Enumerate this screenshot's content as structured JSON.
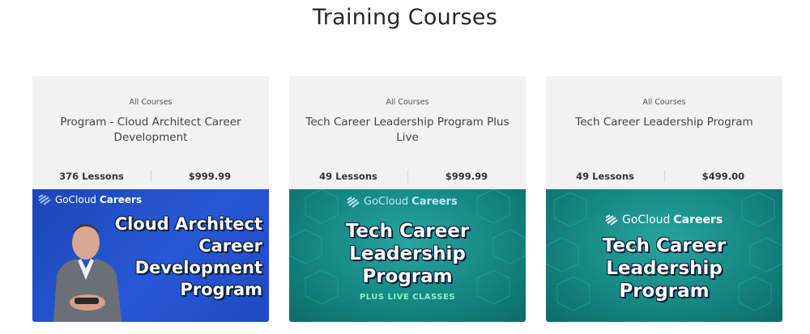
{
  "page": {
    "title": "Training Courses"
  },
  "courses": [
    {
      "category": "All Courses",
      "title": "Program - Cloud Architect Career Development",
      "lessons": "376 Lessons",
      "price": "$999.99",
      "thumbnail": {
        "brand_prefix": "GoCloud",
        "brand_suffix": "Careers",
        "lines": [
          "Cloud Architect",
          "Career",
          "Development",
          "Program"
        ]
      }
    },
    {
      "category": "All Courses",
      "title": "Tech Career Leadership Program Plus Live",
      "lessons": "49 Lessons",
      "price": "$999.99",
      "thumbnail": {
        "brand_prefix": "GoCloud",
        "brand_suffix": "Careers",
        "lines": [
          "Tech Career",
          "Leadership",
          "Program"
        ],
        "subtitle": "PLUS LIVE CLASSES"
      }
    },
    {
      "category": "All Courses",
      "title": "Tech Career Leadership Program",
      "lessons": "49 Lessons",
      "price": "$499.00",
      "thumbnail": {
        "brand_prefix": "GoCloud",
        "brand_suffix": "Careers",
        "lines": [
          "Tech Career",
          "Leadership",
          "Program"
        ]
      }
    }
  ],
  "icons": {
    "brand_logo": "gocloudcareers-logo-icon"
  },
  "colors": {
    "blue_thumb": "#2858d6",
    "teal_thumb": "#14847f",
    "card_bg": "#f2f2f2"
  }
}
